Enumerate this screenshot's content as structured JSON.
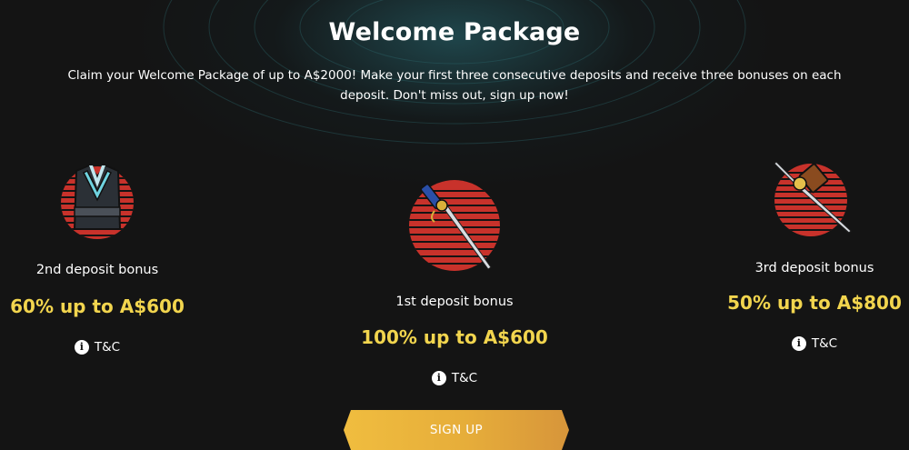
{
  "header": {
    "title": "Welcome Package",
    "subtitle": "Claim your Welcome Package of up to A$2000! Make your first three consecutive deposits and receive three bonuses on each deposit. Don't miss out, sign up now!"
  },
  "bonuses": [
    {
      "label": "2nd deposit bonus",
      "amount": "60% up to A$600",
      "tc": "T&C",
      "icon": "kimono-armor-icon"
    },
    {
      "label": "1st deposit bonus",
      "amount": "100% up to A$600",
      "tc": "T&C",
      "icon": "katana-icon"
    },
    {
      "label": "3rd deposit bonus",
      "amount": "50% up to A$800",
      "tc": "T&C",
      "icon": "war-hammer-icon"
    }
  ],
  "cta": {
    "label": "SIGN UP"
  },
  "colors": {
    "background": "#141414",
    "accent_gold": "#f2d54e",
    "emblem_red": "#c8322b",
    "button_gold": "#e9b43c"
  }
}
